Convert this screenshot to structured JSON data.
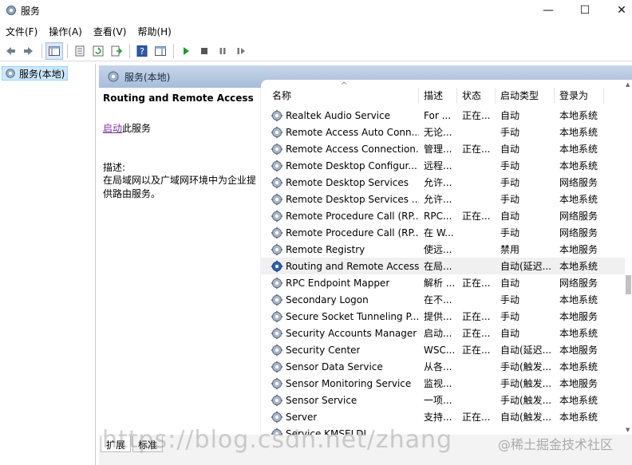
{
  "window": {
    "title": "服务",
    "minimize": "—",
    "maximize": "☐",
    "close": "✕"
  },
  "menu": [
    "文件(F)",
    "操作(A)",
    "查看(V)",
    "帮助(H)"
  ],
  "tree": {
    "item": "服务(本地)"
  },
  "pane": {
    "header": "服务(本地)"
  },
  "description": {
    "title": "Routing and Remote Access",
    "start_link": "启动",
    "start_suffix": "此服务",
    "label": "描述:",
    "text": "在局域网以及广域网环境中为企业提供路由服务。"
  },
  "columns": [
    "名称",
    "描述",
    "状态",
    "启动类型",
    "登录为"
  ],
  "rows": [
    {
      "name": "Realtek Audio Service",
      "desc": "For ...",
      "status": "正在...",
      "start": "自动",
      "logon": "本地系统"
    },
    {
      "name": "Remote Access Auto Conn...",
      "desc": "无论...",
      "status": "",
      "start": "手动",
      "logon": "本地系统"
    },
    {
      "name": "Remote Access Connection...",
      "desc": "管理...",
      "status": "正在...",
      "start": "自动",
      "logon": "本地系统"
    },
    {
      "name": "Remote Desktop Configur...",
      "desc": "远程...",
      "status": "",
      "start": "手动",
      "logon": "本地系统"
    },
    {
      "name": "Remote Desktop Services",
      "desc": "允许...",
      "status": "",
      "start": "手动",
      "logon": "网络服务"
    },
    {
      "name": "Remote Desktop Services ...",
      "desc": "允许...",
      "status": "",
      "start": "手动",
      "logon": "本地系统"
    },
    {
      "name": "Remote Procedure Call (RP...",
      "desc": "RPC...",
      "status": "正在...",
      "start": "自动",
      "logon": "网络服务"
    },
    {
      "name": "Remote Procedure Call (RP...",
      "desc": "在 W...",
      "status": "",
      "start": "手动",
      "logon": "网络服务"
    },
    {
      "name": "Remote Registry",
      "desc": "使远...",
      "status": "",
      "start": "禁用",
      "logon": "本地服务"
    },
    {
      "name": "Routing and Remote Access",
      "desc": "在局...",
      "status": "",
      "start": "自动(延迟...",
      "logon": "本地系统",
      "selected": true
    },
    {
      "name": "RPC Endpoint Mapper",
      "desc": "解析 ...",
      "status": "正在...",
      "start": "自动",
      "logon": "网络服务"
    },
    {
      "name": "Secondary Logon",
      "desc": "在不...",
      "status": "",
      "start": "手动",
      "logon": "本地系统"
    },
    {
      "name": "Secure Socket Tunneling P...",
      "desc": "提供...",
      "status": "正在...",
      "start": "手动",
      "logon": "本地服务"
    },
    {
      "name": "Security Accounts Manager",
      "desc": "启动...",
      "status": "正在...",
      "start": "自动",
      "logon": "本地系统"
    },
    {
      "name": "Security Center",
      "desc": "WSC...",
      "status": "正在...",
      "start": "自动(延迟...",
      "logon": "本地服务"
    },
    {
      "name": "Sensor Data Service",
      "desc": "从各...",
      "status": "",
      "start": "手动(触发...",
      "logon": "本地系统"
    },
    {
      "name": "Sensor Monitoring Service",
      "desc": "监视...",
      "status": "",
      "start": "手动(触发...",
      "logon": "本地服务"
    },
    {
      "name": "Sensor Service",
      "desc": "一项...",
      "status": "",
      "start": "手动(触发...",
      "logon": "本地系统"
    },
    {
      "name": "Server",
      "desc": "支持...",
      "status": "正在...",
      "start": "自动(触发...",
      "logon": "本地系统"
    },
    {
      "name": "Service KMSELDI",
      "desc": "",
      "status": "",
      "start": "",
      "logon": ""
    }
  ],
  "tabs": [
    "扩展",
    "标准"
  ],
  "watermark": "https://blog.csdn.net/zhang",
  "watermark2": "@稀土掘金技术社区",
  "colors": {
    "header": "#a6bcd8",
    "selection": "#cde8ff",
    "link": "#7a2f9e"
  }
}
